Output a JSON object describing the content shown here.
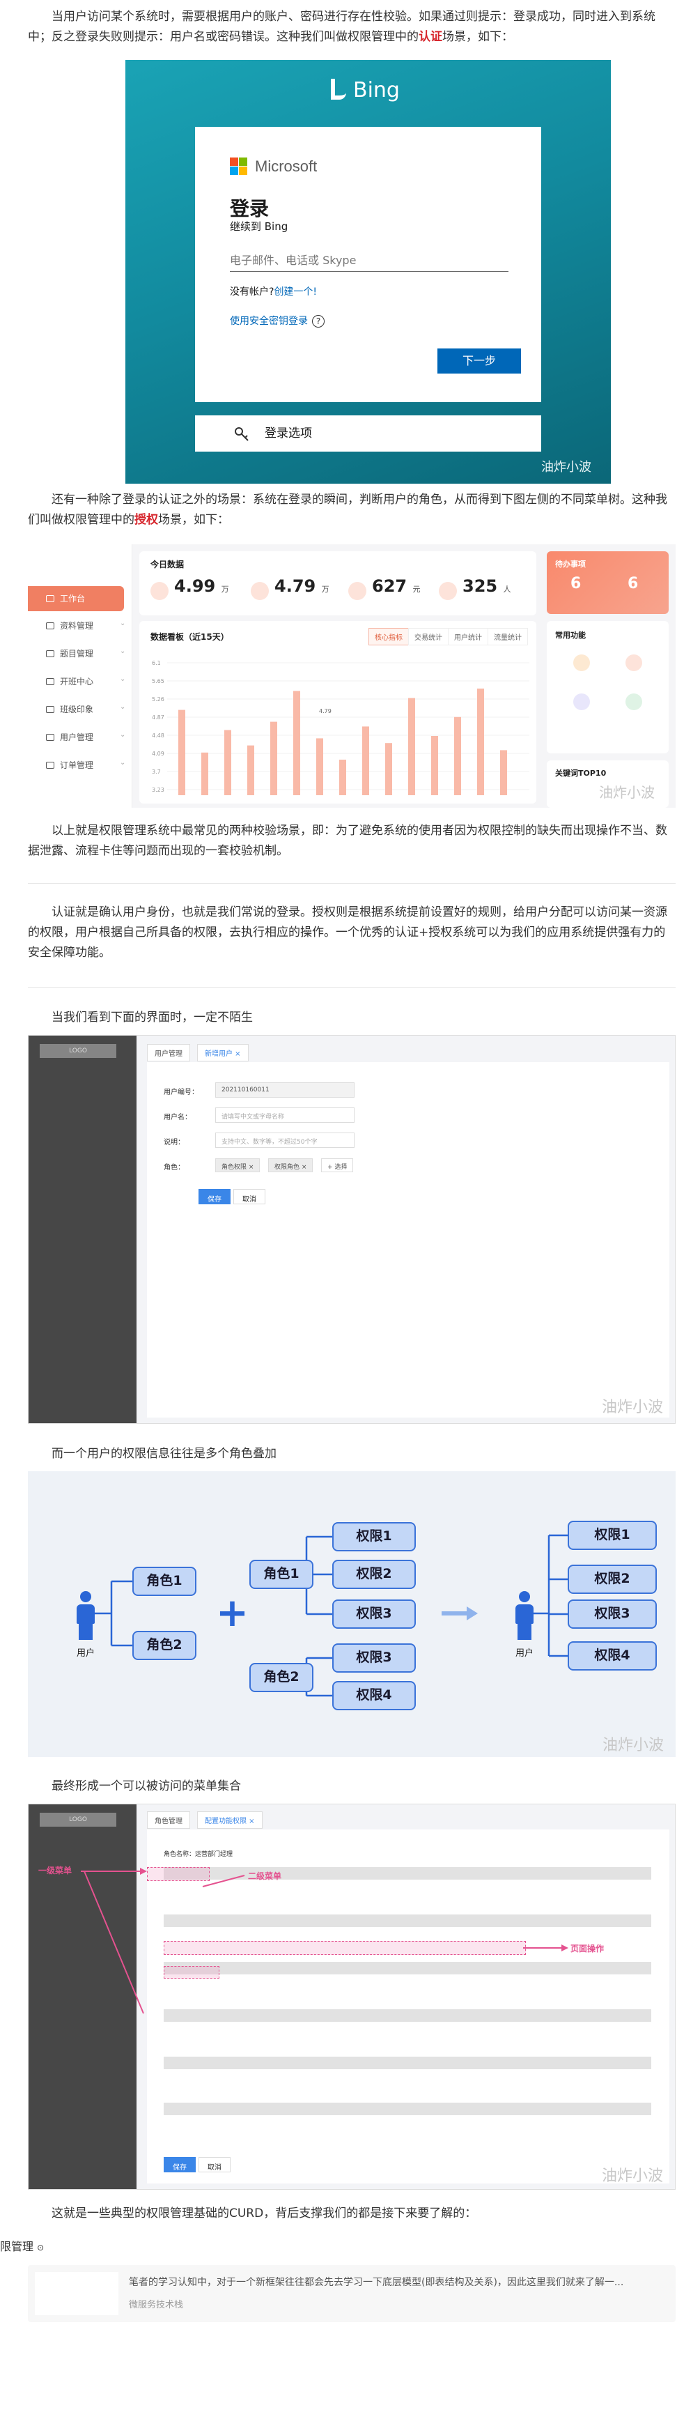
{
  "paragraphs": {
    "p1": "当用户访问某个系统时，需要根据用户的账户、密码进行存在性校验。如果通过则提示：登录成功，同时进入到系统中；反之登录失败则提示：用户名或密码错误。这种我们叫做权限管理中的",
    "p1_red": "认证",
    "p1_end": "场景，如下：",
    "p2": "还有一种除了登录的认证之外的场景：系统在登录的瞬间，判断用户的角色，从而得到下图左侧的不同菜单树。这种我们叫做权限管理中的",
    "p2_red": "授权",
    "p2_end": "场景，如下：",
    "p3": "以上就是权限管理系统中最常见的两种校验场景，即：为了避免系统的使用者因为权限控制的缺失而出现操作不当、数据泄露、流程卡住等问题而出现的一套校验机制。",
    "p4": "认证就是确认用户身份，也就是我们常说的登录。授权则是根据系统提前设置好的规则，给用户分配可以访问某一资源的权限，用户根据自己所具备的权限，去执行相应的操作。一个优秀的认证+授权系统可以为我们的应用系统提供强有力的安全保障功能。",
    "p5": "当我们看到下面的界面时，一定不陌生",
    "p6": "而一个用户的权限信息往往是多个角色叠加",
    "p7": "最终形成一个可以被访问的菜单集合",
    "p8": "这就是一些典型的权限管理基础的CURD，背后支撑我们的都是接下来要了解的："
  },
  "watermark": "油炸小波",
  "bing": {
    "brand": "Bing",
    "ms": "Microsoft",
    "title": "登录",
    "subtitle": "继续到 Bing",
    "placeholder": "电子邮件、电话或 Skype",
    "no_account": "没有帐户?",
    "create": "创建一个!",
    "security_key": "使用安全密钥登录",
    "next": "下一步",
    "options": "登录选项"
  },
  "dashboard": {
    "menu": [
      "工作台",
      "资料管理",
      "题目管理",
      "开班中心",
      "班级印象",
      "用户管理",
      "订单管理"
    ],
    "today": "今日数据",
    "kpis": [
      {
        "value": "4.99",
        "unit": "万"
      },
      {
        "value": "4.79",
        "unit": "万"
      },
      {
        "value": "627",
        "unit": "元"
      },
      {
        "value": "325",
        "unit": "人"
      }
    ],
    "trend_title": "数据看板（近15天）",
    "tabs": [
      "核心指标",
      "交易统计",
      "用户统计",
      "流量统计"
    ],
    "y_ticks": [
      "6.1",
      "5.65",
      "5.26",
      "4.87",
      "4.48",
      "4.09",
      "3.7",
      "3.23"
    ],
    "bar_label": "4.79",
    "pending_title": "待办事项",
    "pending": [
      "6",
      "6"
    ],
    "common_title": "常用功能",
    "functions": [
      "",
      "",
      "",
      ""
    ],
    "keywords_title": "关键词TOP10"
  },
  "admin": {
    "logo": "LOGO",
    "tabs": [
      "用户管理",
      "新增用户 ×"
    ],
    "labels": [
      "用户编号：",
      "用户名：",
      "说明：",
      "角色："
    ],
    "user_id": "202110160011",
    "name_placeholder": "请填写中文或字母名称",
    "desc_placeholder": "支持中文、数字等，不超过50个字",
    "roles": [
      "角色权限 ×",
      "权限角色 ×"
    ],
    "add": "+ 选择",
    "save": "保存",
    "cancel": "取消"
  },
  "diagram": {
    "user": "用户",
    "roles": [
      "角色1",
      "角色2"
    ],
    "perms": [
      "权限1",
      "权限2",
      "权限3",
      "权限3",
      "权限4"
    ],
    "result": [
      "权限1",
      "权限2",
      "权限3",
      "权限4"
    ]
  },
  "menu": {
    "logo": "LOGO",
    "tabs": [
      "角色管理",
      "配置功能权限 ×"
    ],
    "role_name": "角色名称：运营部门经理",
    "level1": "一级菜单",
    "level2": "二级菜单",
    "page_op": "页面操作",
    "save": "保存",
    "cancel": "取消"
  },
  "link": {
    "title": "限管理",
    "desc": "笔者的学习认知中，对于一个新框架往往都会先去学习一下底层模型(即表结构及关系)，因此这里我们就来了解一...",
    "source": "微服务技术栈"
  }
}
